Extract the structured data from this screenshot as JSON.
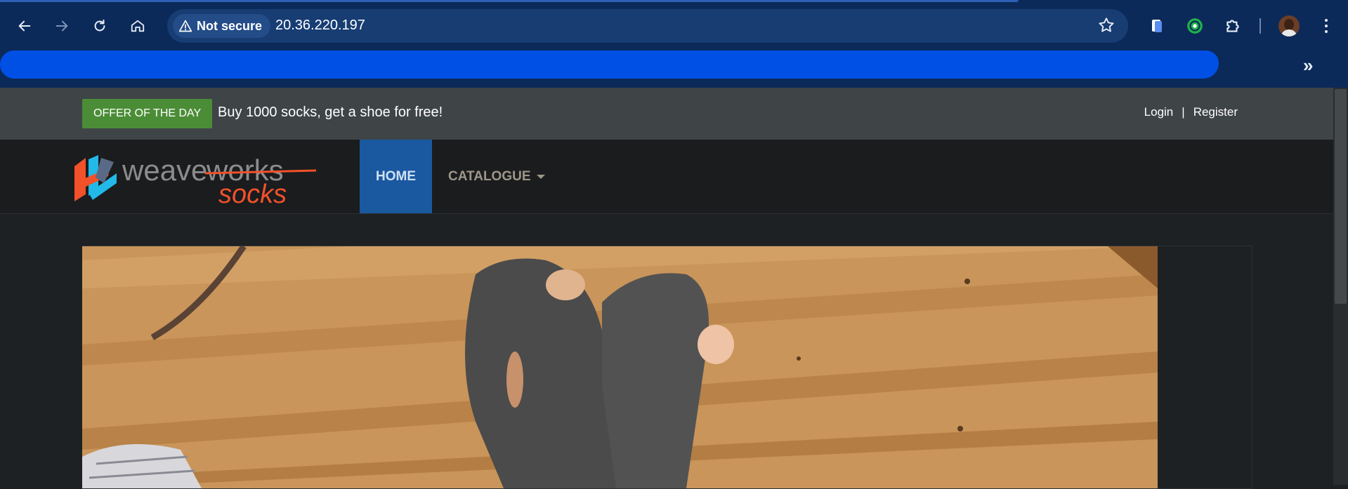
{
  "browser": {
    "security_label": "Not secure",
    "url": "20.36.220.197",
    "icons": {
      "back": "arrow-left-icon",
      "forward": "arrow-right-icon",
      "reload": "reload-icon",
      "home": "home-icon",
      "warning": "warning-triangle-icon",
      "bookmark": "star-icon",
      "extensions": "puzzle-icon",
      "more_bookmarks": "chevron-double-right-icon",
      "menu": "kebab-menu-icon"
    },
    "colors": {
      "frame": "#0b2a59",
      "omnibox": "#173d73",
      "redaction": "#0050e6"
    }
  },
  "bookmarks": {
    "more_label": "»"
  },
  "site": {
    "offer_badge": "OFFER OF THE DAY",
    "offer_text": "Buy 1000 socks, get a shoe for free!",
    "login": "Login",
    "auth_separator": "|",
    "register": "Register",
    "logo": {
      "brand_word": "weave",
      "brand_word_struck": "works",
      "product_word": "socks"
    },
    "nav": [
      {
        "label": "HOME"
      },
      {
        "label": "CATALOGUE"
      }
    ],
    "colors": {
      "offer": "#4a8d36",
      "active_nav": "#1a58a0",
      "topbar": "#3f4447",
      "navbar": "#1a1c1e",
      "logo_accent": "#f2512a"
    }
  }
}
